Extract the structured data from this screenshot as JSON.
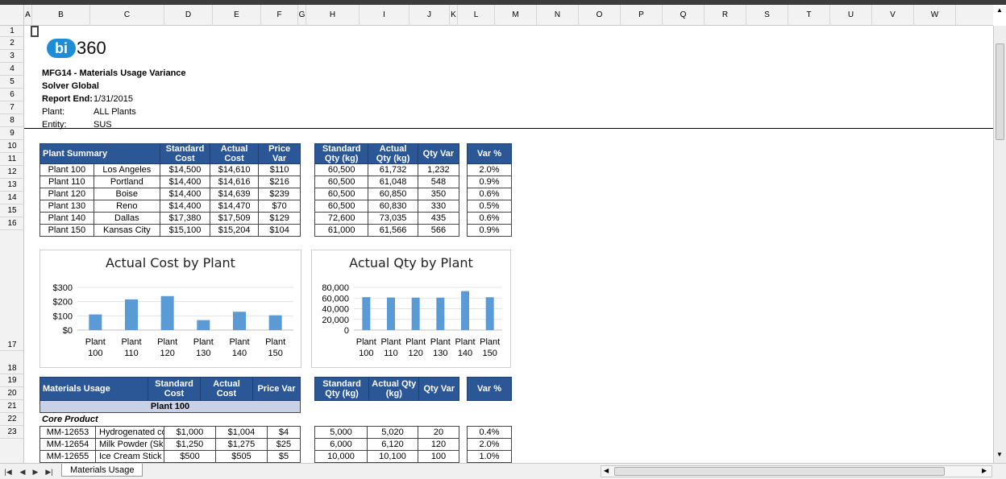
{
  "columns": [
    "A",
    "B",
    "C",
    "D",
    "E",
    "F",
    "G",
    "H",
    "I",
    "J",
    "K",
    "L",
    "M",
    "N",
    "O",
    "P",
    "Q",
    "R",
    "S",
    "T",
    "U",
    "V",
    "W"
  ],
  "rows": [
    "1",
    "2",
    "3",
    "4",
    "5",
    "6",
    "7",
    "8",
    "9",
    "10",
    "11",
    "12",
    "13",
    "14",
    "15",
    "16",
    "17",
    "18",
    "19",
    "20",
    "21",
    "22",
    "23"
  ],
  "logo": {
    "mark": "bi",
    "text": "360"
  },
  "header": {
    "title": "MFG14 - Materials Usage Variance",
    "company": "Solver Global",
    "report_end_label": "Report End:",
    "report_end_value": "1/31/2015",
    "plant_label": "Plant:",
    "plant_value": "ALL Plants",
    "entity_label": "Entity:",
    "entity_value": "SUS"
  },
  "summary": {
    "headers": {
      "name": "Plant Summary",
      "std_cost": "Standard Cost",
      "act_cost": "Actual Cost",
      "price_var": "Price Var",
      "std_qty": "Standard Qty (kg)",
      "act_qty": "Actual Qty (kg)",
      "qty_var": "Qty Var",
      "var_pct": "Var %"
    },
    "rows": [
      {
        "plant": "Plant 100",
        "city": "Los Angeles",
        "std_cost": "$14,500",
        "act_cost": "$14,610",
        "price_var": "$110",
        "std_qty": "60,500",
        "act_qty": "61,732",
        "qty_var": "1,232",
        "var_pct": "2.0%"
      },
      {
        "plant": "Plant 110",
        "city": "Portland",
        "std_cost": "$14,400",
        "act_cost": "$14,616",
        "price_var": "$216",
        "std_qty": "60,500",
        "act_qty": "61,048",
        "qty_var": "548",
        "var_pct": "0.9%"
      },
      {
        "plant": "Plant 120",
        "city": "Boise",
        "std_cost": "$14,400",
        "act_cost": "$14,639",
        "price_var": "$239",
        "std_qty": "60,500",
        "act_qty": "60,850",
        "qty_var": "350",
        "var_pct": "0.6%"
      },
      {
        "plant": "Plant 130",
        "city": "Reno",
        "std_cost": "$14,400",
        "act_cost": "$14,470",
        "price_var": "$70",
        "std_qty": "60,500",
        "act_qty": "60,830",
        "qty_var": "330",
        "var_pct": "0.5%"
      },
      {
        "plant": "Plant 140",
        "city": "Dallas",
        "std_cost": "$17,380",
        "act_cost": "$17,509",
        "price_var": "$129",
        "std_qty": "72,600",
        "act_qty": "73,035",
        "qty_var": "435",
        "var_pct": "0.6%"
      },
      {
        "plant": "Plant 150",
        "city": "Kansas City",
        "std_cost": "$15,100",
        "act_cost": "$15,204",
        "price_var": "$104",
        "std_qty": "61,000",
        "act_qty": "61,566",
        "qty_var": "566",
        "var_pct": "0.9%"
      }
    ]
  },
  "chart_data": [
    {
      "type": "bar",
      "title": "Actual Cost by Plant",
      "categories": [
        "Plant 100",
        "Plant 110",
        "Plant 120",
        "Plant 130",
        "Plant 140",
        "Plant 150"
      ],
      "values": [
        110,
        216,
        239,
        70,
        129,
        104
      ],
      "yticks": [
        "$0",
        "$100",
        "$200",
        "$300"
      ],
      "ylim": [
        0,
        300
      ],
      "grid": true,
      "color": "#5b9bd5"
    },
    {
      "type": "bar",
      "title": "Actual Qty by Plant",
      "categories": [
        "Plant 100",
        "Plant 110",
        "Plant 120",
        "Plant 130",
        "Plant 140",
        "Plant 150"
      ],
      "values": [
        61732,
        61048,
        60850,
        60830,
        73035,
        61566
      ],
      "yticks": [
        "0",
        "20,000",
        "40,000",
        "60,000",
        "80,000"
      ],
      "ylim": [
        0,
        80000
      ],
      "grid": true,
      "color": "#5b9bd5"
    }
  ],
  "materials": {
    "headers": {
      "name": "Materials Usage",
      "std_cost": "Standard Cost",
      "act_cost": "Actual Cost",
      "price_var": "Price Var",
      "std_qty": "Standard Qty (kg)",
      "act_qty": "Actual Qty (kg)",
      "qty_var": "Qty Var",
      "var_pct": "Var %"
    },
    "group": "Plant 100",
    "section": "Core Product",
    "rows": [
      {
        "code": "MM-12653",
        "desc": "Hydrogenated coco",
        "std_cost": "$1,000",
        "act_cost": "$1,004",
        "price_var": "$4",
        "std_qty": "5,000",
        "act_qty": "5,020",
        "qty_var": "20",
        "var_pct": "0.4%"
      },
      {
        "code": "MM-12654",
        "desc": "Milk Powder (Skim",
        "std_cost": "$1,250",
        "act_cost": "$1,275",
        "price_var": "$25",
        "std_qty": "6,000",
        "act_qty": "6,120",
        "qty_var": "120",
        "var_pct": "2.0%"
      },
      {
        "code": "MM-12655",
        "desc": "Ice Cream Stick",
        "std_cost": "$500",
        "act_cost": "$505",
        "price_var": "$5",
        "std_qty": "10,000",
        "act_qty": "10,100",
        "qty_var": "100",
        "var_pct": "1.0%"
      }
    ]
  },
  "sheet_tab": "Materials Usage",
  "nav": {
    "first": "|◀",
    "prev": "◀",
    "next": "▶",
    "last": "▶|"
  }
}
